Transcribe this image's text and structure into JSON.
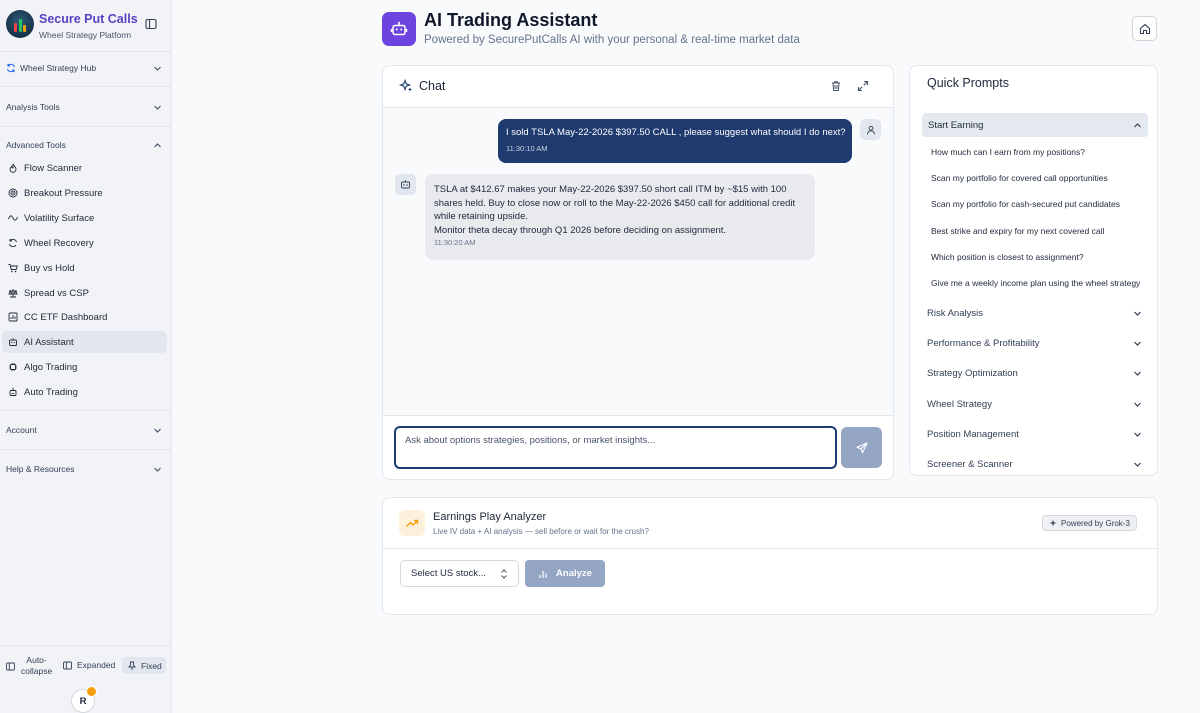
{
  "sidebar": {
    "brand_title": "Secure Put Calls",
    "brand_subtitle": "Wheel Strategy Platform",
    "sections": {
      "wheel_hub": "Wheel Strategy Hub",
      "analysis_tools": "Analysis Tools",
      "advanced_tools": "Advanced Tools",
      "account": "Account",
      "help": "Help & Resources"
    },
    "items": [
      {
        "label": "Flow Scanner",
        "icon": "flame-icon"
      },
      {
        "label": "Breakout Pressure",
        "icon": "target-icon"
      },
      {
        "label": "Volatility Surface",
        "icon": "wave-icon"
      },
      {
        "label": "Wheel Recovery",
        "icon": "refresh-icon"
      },
      {
        "label": "Buy vs Hold",
        "icon": "cart-icon"
      },
      {
        "label": "Spread vs CSP",
        "icon": "scale-icon"
      },
      {
        "label": "CC ETF Dashboard",
        "icon": "dashboard-icon"
      },
      {
        "label": "AI Assistant",
        "icon": "bot-icon",
        "active": true
      },
      {
        "label": "Algo Trading",
        "icon": "chip-icon"
      },
      {
        "label": "Auto Trading",
        "icon": "robot-icon"
      }
    ],
    "footer": {
      "auto_collapse_line1": "Auto-",
      "auto_collapse_line2": "collapse",
      "expanded": "Expanded",
      "fixed": "Fixed"
    },
    "avatar_initial": "R"
  },
  "header": {
    "title": "AI Trading Assistant",
    "subtitle": "Powered by SecurePutCalls AI with your personal & real-time market data"
  },
  "chat": {
    "title": "Chat",
    "messages": {
      "user": {
        "text": "I sold TSLA May-22-2026 $397.50 CALL , please suggest what should I do next?",
        "time": "11:30:10 AM"
      },
      "bot": {
        "lines": [
          "TSLA at $412.67 makes your May-22-2026 $397.50 short call ITM by ~$15 with 100",
          "shares held. Buy to close now or roll to the May-22-2026 $450 call for additional credit",
          "while retaining upside.",
          "Monitor theta decay through Q1 2026 before deciding on assignment."
        ],
        "time": "11:30:20 AM"
      }
    },
    "input_placeholder": "Ask about options strategies, positions, or market insights..."
  },
  "quick_prompts": {
    "title": "Quick Prompts",
    "active_category": "Start Earning",
    "prompts": [
      "How much can I earn from my positions?",
      "Scan my portfolio for covered call opportunities",
      "Scan my portfolio for cash-secured put candidates",
      "Best strike and expiry for my next covered call",
      "Which position is closest to assignment?",
      "Give me a weekly income plan using the wheel strategy"
    ],
    "categories": [
      "Risk Analysis",
      "Performance & Profitability",
      "Strategy Optimization",
      "Wheel Strategy",
      "Position Management",
      "Screener & Scanner"
    ]
  },
  "earnings": {
    "title": "Earnings Play Analyzer",
    "subtitle": "Live IV data + AI analysis — sell before or wait for the crush?",
    "badge": "Powered by Grok-3",
    "select_placeholder": "Select US stock...",
    "analyze_label": "Analyze"
  },
  "colors": {
    "brand_purple": "#6d44e0",
    "user_bubble": "#1e3a6e",
    "disabled_button": "#94a6c4",
    "earnings_icon": "#f59e0b"
  }
}
